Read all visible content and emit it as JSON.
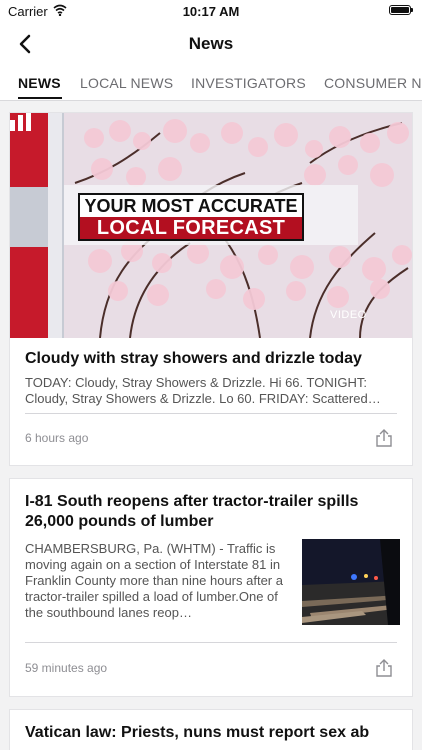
{
  "status": {
    "carrier": "Carrier",
    "time": "10:17 AM"
  },
  "nav": {
    "title": "News"
  },
  "tabs": [
    {
      "label": "NEWS",
      "active": true
    },
    {
      "label": "LOCAL NEWS"
    },
    {
      "label": "INVESTIGATORS"
    },
    {
      "label": "CONSUMER NE"
    }
  ],
  "stories": [
    {
      "title": "Cloudy with stray showers and drizzle today",
      "summary": "TODAY: Cloudy, Stray Showers & Drizzle. Hi 66. TONIGHT: Cloudy, Stray Showers & Drizzle. Lo 60. FRIDAY: Scattered…",
      "time": "6 hours ago",
      "image_overlay_top": "YOUR MOST ACCURATE",
      "image_overlay_bottom": "LOCAL FORECAST",
      "video_label": "VIDEO"
    },
    {
      "title": "I-81 South reopens after tractor-trailer spills 26,000 pounds of lumber",
      "summary": "CHAMBERSBURG, Pa. (WHTM) - Traffic is moving again on a section of Interstate 81 in Franklin County more than nine hours after a tractor-trailer spilled a load of lumber.One of the southbound lanes reop…",
      "time": "59 minutes ago"
    },
    {
      "title": "Vatican law: Priests, nuns must report sex ab"
    }
  ],
  "colors": {
    "accent_red": "#b30f20",
    "background": "#f2f2f3"
  }
}
